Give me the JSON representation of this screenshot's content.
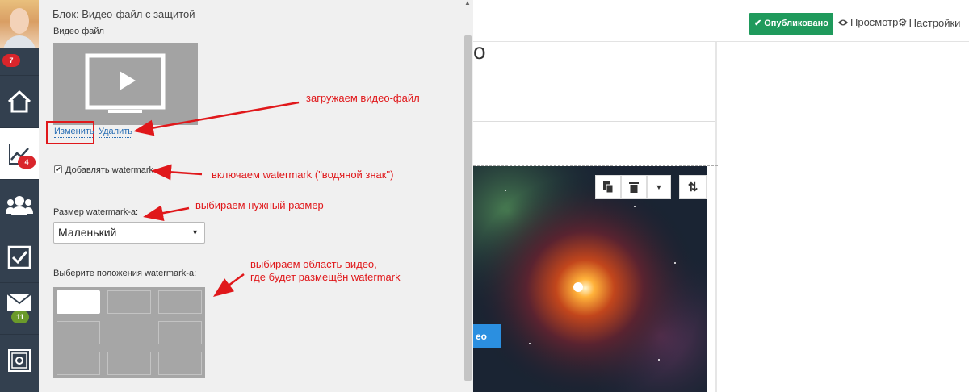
{
  "sidebar": {
    "badges": {
      "avatar": "7",
      "stats": "4",
      "mail": "11"
    },
    "icons": [
      "home-icon",
      "chart-icon",
      "users-icon",
      "checkbox-icon",
      "mail-icon",
      "safe-icon"
    ]
  },
  "panel": {
    "title": "Блок: Видео-файл с защитой",
    "video_label": "Видео файл",
    "change_link": "Изменить",
    "delete_link": "Удалить",
    "watermark_checkbox_label": "Добавлять watermark",
    "watermark_checked": true,
    "size_label": "Размер watermark-а:",
    "size_value": "Маленький",
    "position_label": "Выберите положения watermark-а:",
    "selected_position": 0
  },
  "annotations": {
    "upload": "загружаем видео-файл",
    "enable": "включаем watermark (\"водяной знак\")",
    "size": "выбираем нужный размер",
    "area_line1": "выбираем область видео,",
    "area_line2": "где будет размещён watermark"
  },
  "topbar": {
    "published": "Опубликовано",
    "preview": "Просмотр",
    "settings": "Настройки"
  },
  "page": {
    "heading_fragment": "о",
    "button_fragment": "ео"
  },
  "colors": {
    "sidebar": "#33404f",
    "published_green": "#1f9a5c",
    "annotation_red": "#e0181b",
    "link_blue": "#2a6fb5"
  }
}
